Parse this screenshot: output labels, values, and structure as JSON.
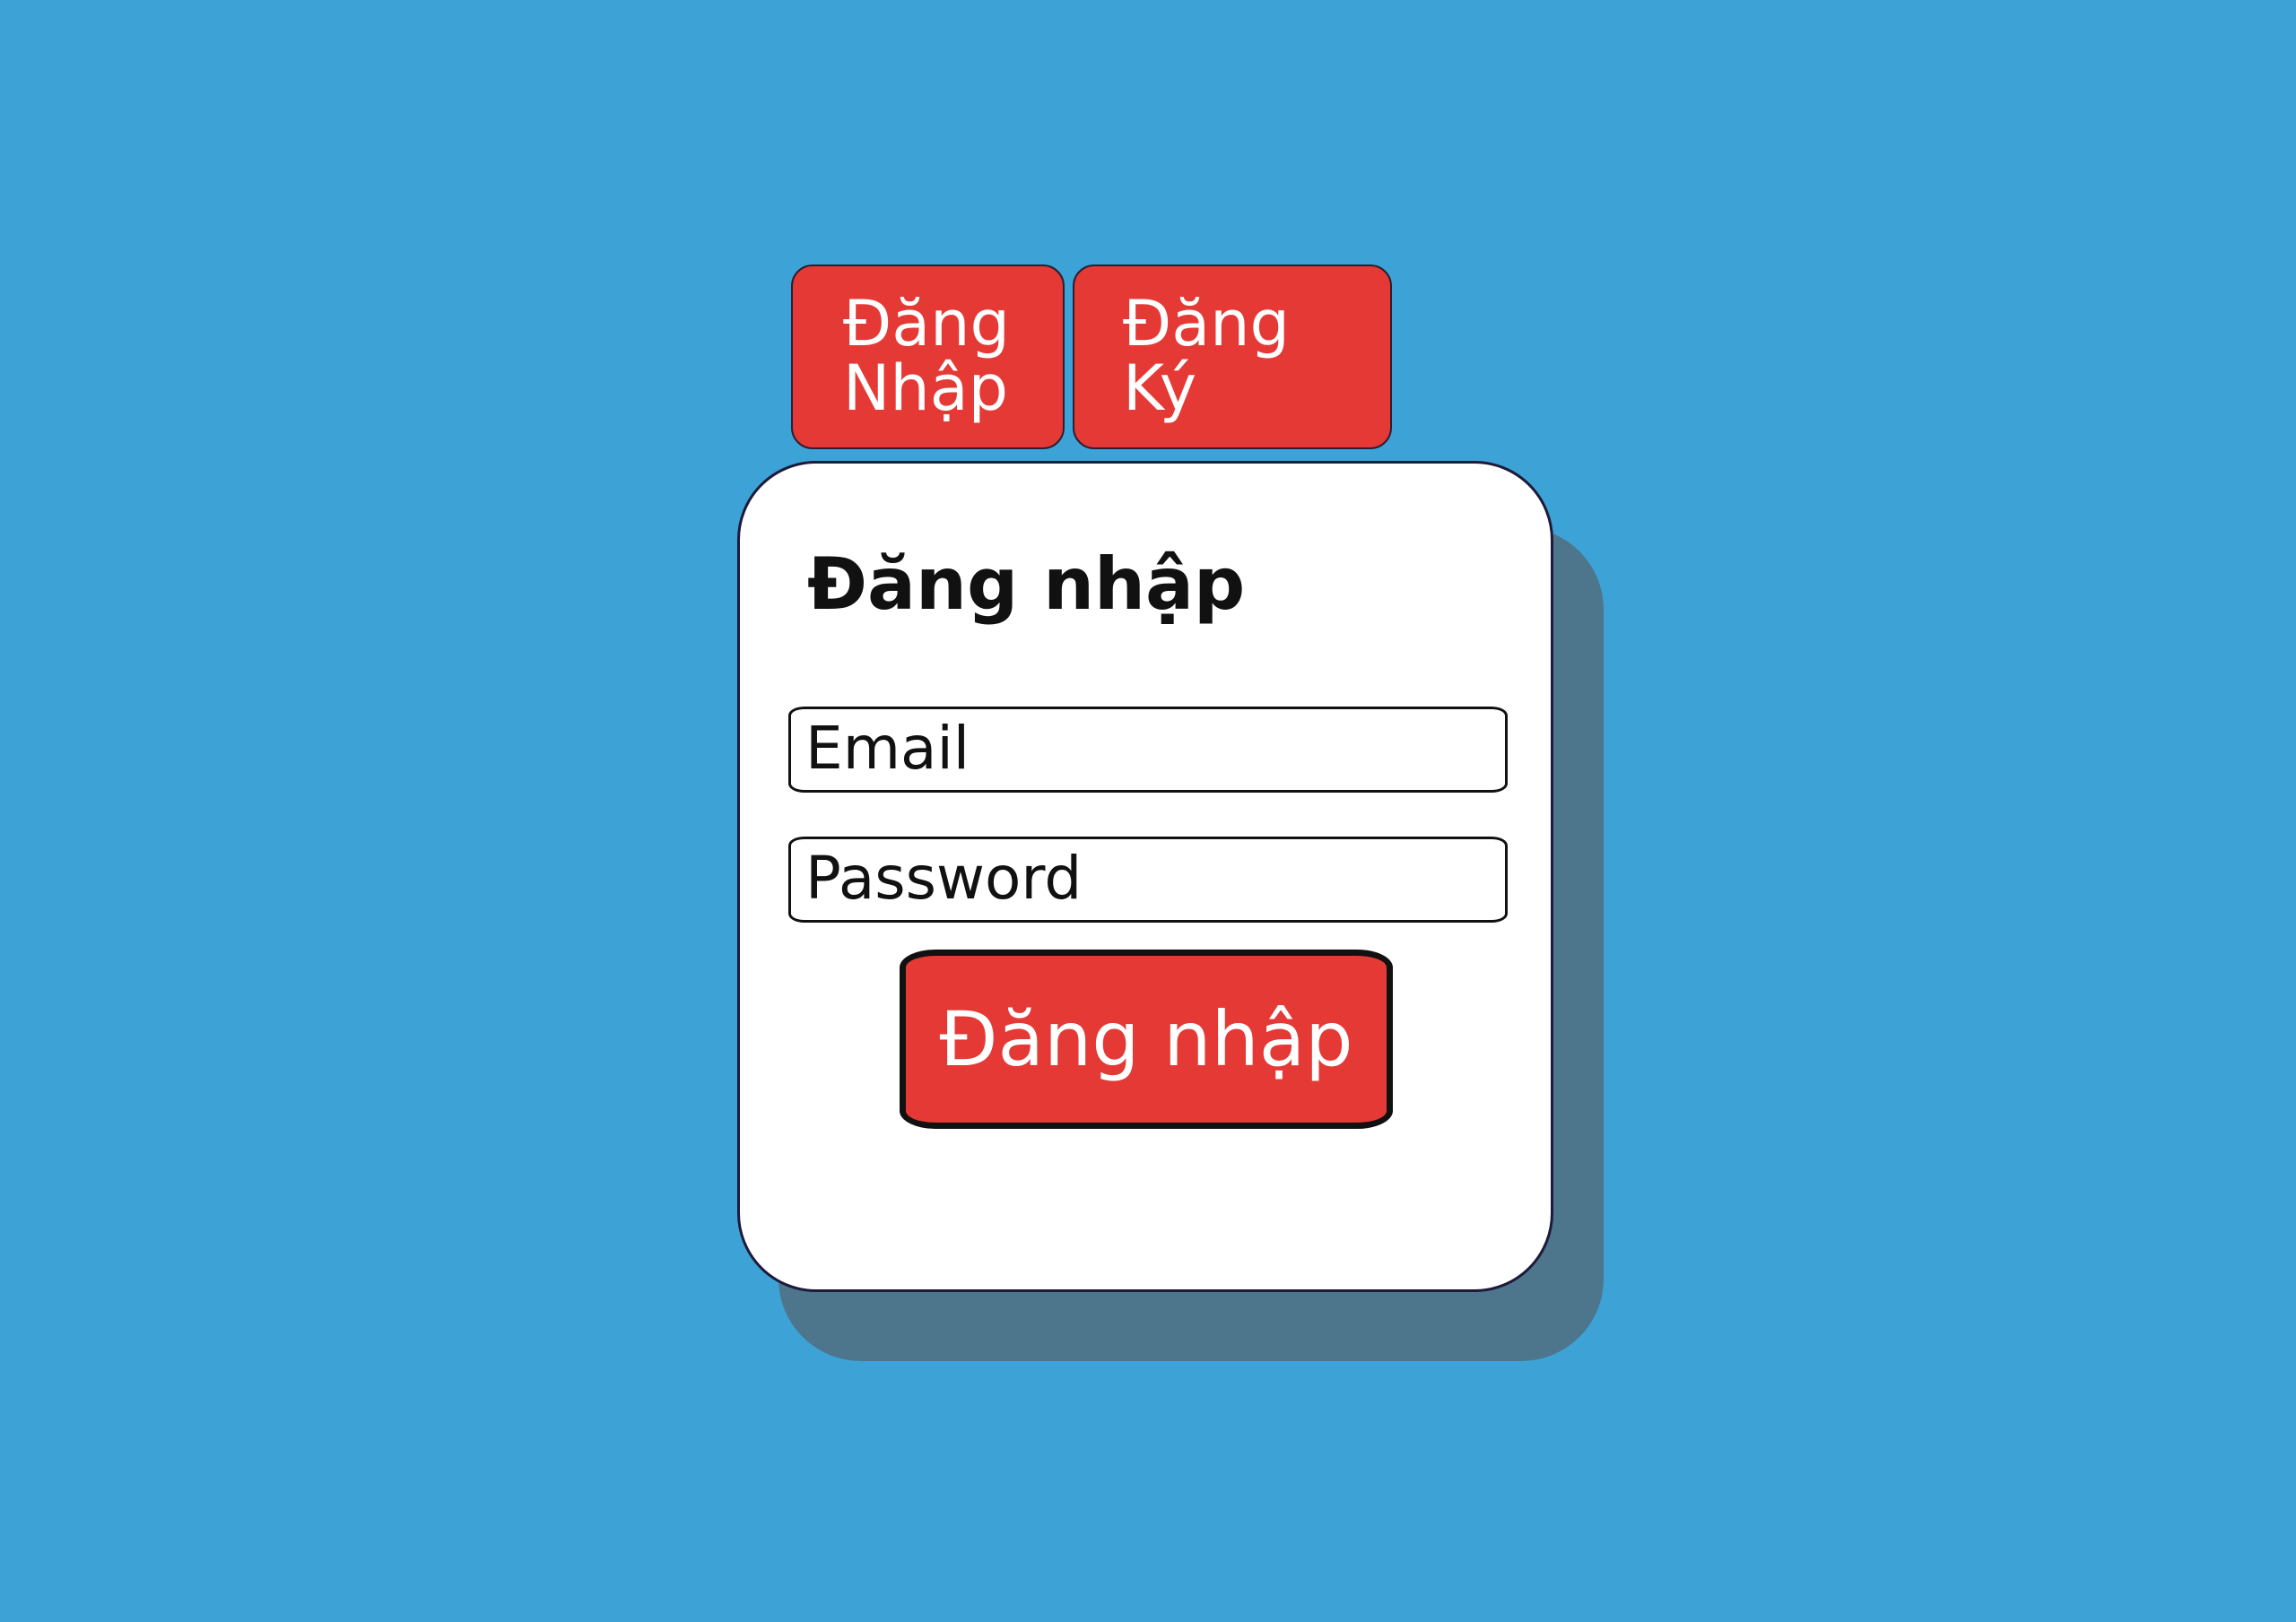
{
  "tabs": {
    "login": {
      "line1": "Đăng",
      "line2": "Nhập"
    },
    "register": {
      "line1": "Đăng",
      "line2": "Ký"
    }
  },
  "form": {
    "title": "Đăng nhập",
    "email_placeholder": "Email",
    "password_placeholder": "Password",
    "submit_label": "Đăng nhập"
  },
  "colors": {
    "background": "#3da3d7",
    "accent": "#e53935",
    "card": "#ffffff",
    "shadow": "#4d758b"
  }
}
